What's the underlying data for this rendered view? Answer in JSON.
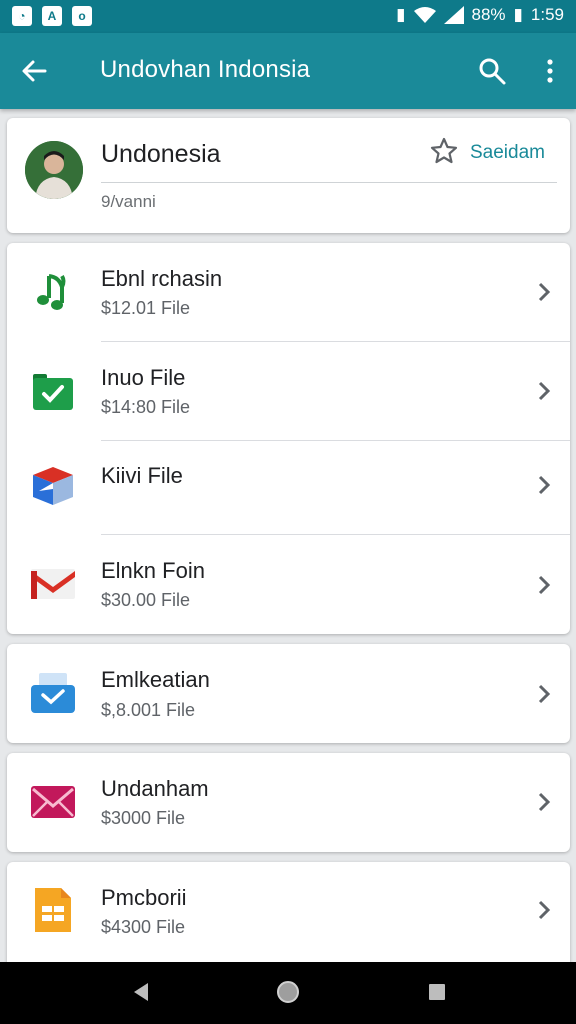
{
  "status_bar": {
    "battery": "88%",
    "time": "1:59",
    "icons": [
      "notification-icon-1",
      "notification-icon-2",
      "notification-icon-3",
      "sim-icon",
      "wifi-icon",
      "signal-icon",
      "battery-icon"
    ]
  },
  "app_bar": {
    "title": "Undovhan Indonsia",
    "back_icon": "arrow-left-icon",
    "search_icon": "search-icon",
    "more_icon": "more-vert-icon"
  },
  "profile": {
    "name": "Undonesia",
    "subtitle": "9/vanni",
    "saved_label": "Saeidam",
    "star_icon": "star-outline-icon"
  },
  "items": [
    {
      "name": "Ebnl rchasin",
      "price": "$12.01 File",
      "icon": "music-note-icon",
      "color": "#1f8f3a"
    },
    {
      "name": "Inuo File",
      "price": "$14:80 File",
      "icon": "green-check-folder-icon",
      "color": "#1e9e4a"
    },
    {
      "name": "Kiivi File",
      "price": "",
      "icon": "blue-red-cube-icon",
      "color": "#2a6fd8"
    },
    {
      "name": "Elnkn Foin",
      "price": "$30.00 File",
      "icon": "gmail-icon",
      "color": "#d93025"
    },
    {
      "name": "Emlkeatian",
      "price": "$,8.001 File",
      "icon": "blue-mail-icon",
      "color": "#2b8bd8"
    },
    {
      "name": "Undanham",
      "price": "$3000 File",
      "icon": "pink-mail-icon",
      "color": "#c2185b"
    },
    {
      "name": "Pmcborii",
      "price": "$4300 File",
      "icon": "orange-doc-icon",
      "color": "#f5a623"
    }
  ],
  "nav_bar": {
    "back": "back-triangle-icon",
    "home": "home-circle-icon",
    "recents": "recents-square-icon"
  }
}
